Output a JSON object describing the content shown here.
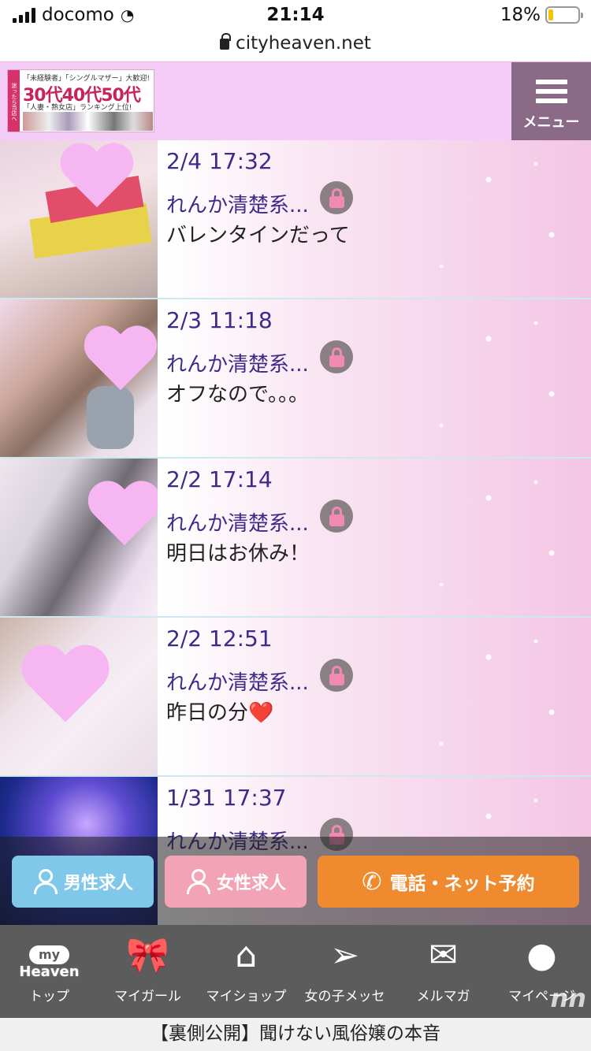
{
  "status": {
    "carrier": "docomo",
    "time": "21:14",
    "battery": "18%"
  },
  "url": "cityheaven.net",
  "header": {
    "banner": {
      "side": "迷ったら当店へ",
      "line1": "「未経験者」「シングルマザー」大歓迎!",
      "line2": "30代40代50代",
      "line3": "「人妻・熟女店」ランキング上位!"
    },
    "menu_label": "メニュー"
  },
  "posts": [
    {
      "date": "2/4 17:32",
      "name": "れんか清楚系...",
      "message": "バレンタインだって"
    },
    {
      "date": "2/3 11:18",
      "name": "れんか清楚系...",
      "message": "オフなので。。。"
    },
    {
      "date": "2/2 17:14",
      "name": "れんか清楚系...",
      "message": "明日はお休み！"
    },
    {
      "date": "2/2 12:51",
      "name": "れんか清楚系...",
      "message": "昨日の分❤️"
    },
    {
      "date": "1/31 17:37",
      "name": "れんか清楚系...",
      "message": ""
    }
  ],
  "actions": {
    "male": "男性求人",
    "female": "女性求人",
    "reserve": "電話・ネット予約"
  },
  "tabs": {
    "myheaven_logo_top": "my",
    "myheaven_logo_bottom": "Heaven",
    "top": "トップ",
    "mygirl": "マイガール",
    "myshop": "マイショップ",
    "girlmsg": "女の子メッセ",
    "mailmag": "メルマガ",
    "mypage": "マイページ"
  },
  "footer": "【裏側公開】聞けない風俗嬢の本音",
  "watermark": "nn",
  "colors": {
    "header_bg": "#f5ccf7",
    "menu_bg": "#8a6a86",
    "text_purple": "#3d2a8a",
    "male": "#7fc8ea",
    "female": "#f2a3b6",
    "reserve": "#ef8a2f"
  }
}
